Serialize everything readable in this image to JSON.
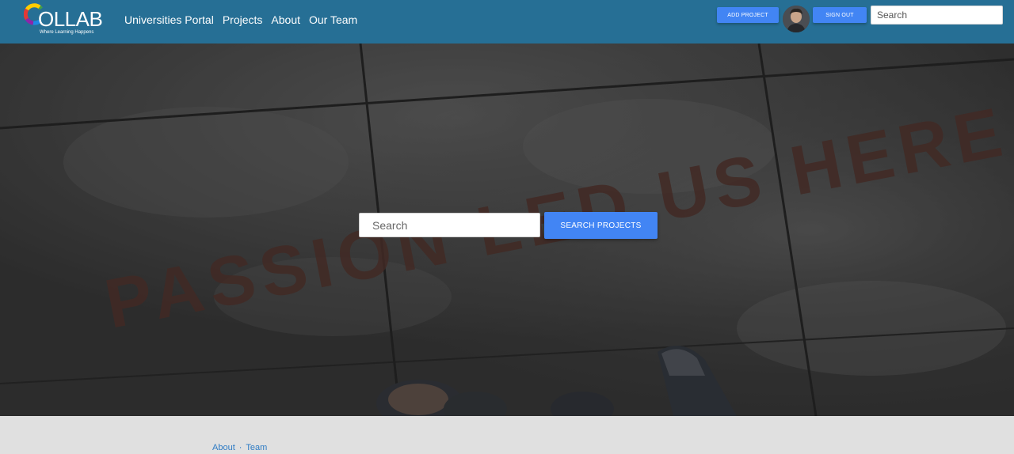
{
  "brand": {
    "name": "OLLAB",
    "tagline": "Where Learning Happens"
  },
  "nav": {
    "links": [
      "Universities Portal",
      "Projects",
      "About",
      "Our Team"
    ],
    "add_project_label": "ADD PROJECT",
    "sign_out_label": "SIGN OUT",
    "search_placeholder": "Search"
  },
  "hero": {
    "background_text": "PASSION LED US HERE",
    "search_placeholder": "Search",
    "search_button_label": "SEARCH PROJECTS"
  },
  "footer": {
    "links": [
      "About",
      "Team"
    ],
    "separator": "·"
  },
  "colors": {
    "navbar": "#266f95",
    "button": "#4285f4",
    "footer_bg": "#e0e0e0",
    "footer_link": "#2e7bc4"
  }
}
